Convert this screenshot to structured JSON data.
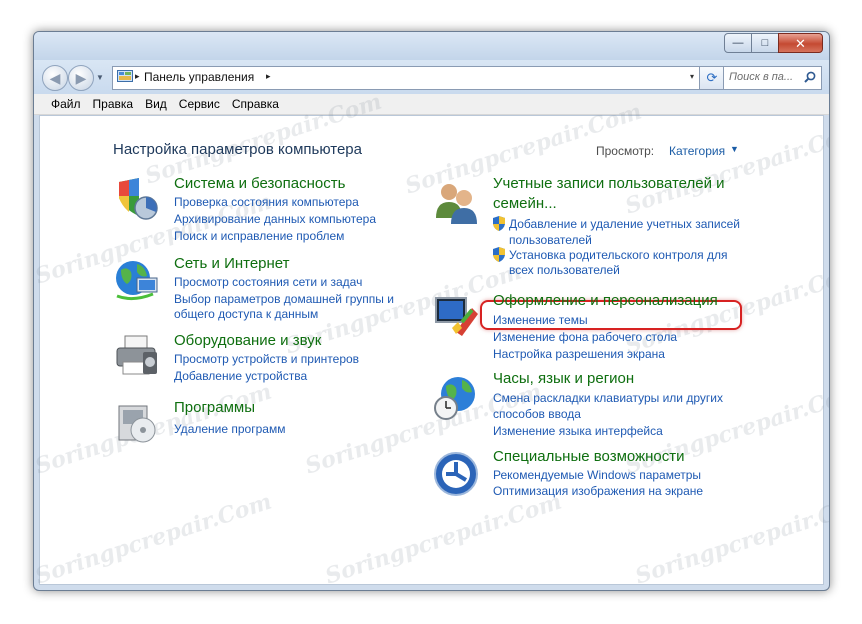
{
  "window": {
    "caption_buttons": {
      "minimize": "—",
      "maximize": "□",
      "close": "✕"
    }
  },
  "nav": {
    "back_icon": "back-arrow-icon",
    "forward_icon": "forward-arrow-icon",
    "address": {
      "separator": "▸",
      "path": "Панель управления",
      "trailing_separator": "▸",
      "dropdown": "▾"
    },
    "refresh_icon": "refresh-icon",
    "search_placeholder": "Поиск в па..."
  },
  "menu": [
    "Файл",
    "Правка",
    "Вид",
    "Сервис",
    "Справка"
  ],
  "content": {
    "title": "Настройка параметров компьютера",
    "view_label": "Просмотр:",
    "view_value": "Категория",
    "view_arrow": "▼",
    "left_categories": [
      {
        "title": "Система и безопасность",
        "icon": "shield-icon",
        "links": [
          "Проверка состояния компьютера",
          "Архивирование данных компьютера",
          "Поиск и исправление проблем"
        ]
      },
      {
        "title": "Сеть и Интернет",
        "icon": "network-globe-icon",
        "links": [
          "Просмотр состояния сети и задач",
          "Выбор параметров домашней группы и",
          "общего доступа к данным"
        ]
      },
      {
        "title": "Оборудование и звук",
        "icon": "printer-icon",
        "links": [
          "Просмотр устройств и принтеров",
          "Добавление устройства"
        ]
      },
      {
        "title": "Программы",
        "icon": "programs-icon",
        "links": [
          "Удаление программ"
        ]
      }
    ],
    "right_categories": [
      {
        "title_line1": "Учетные записи пользователей и",
        "title_line2": "семейн...",
        "icon": "users-icon",
        "links": [
          "Добавление и удаление учетных записей",
          "пользователей",
          "Установка родительского контроля для",
          "всех пользователей"
        ]
      },
      {
        "title": "Оформление и персонализация",
        "icon": "monitor-paint-icon",
        "links": [
          "Изменение темы",
          "Изменение фона рабочего стола",
          "Настройка разрешения экрана"
        ]
      },
      {
        "title": "Часы, язык и регион",
        "icon": "clock-globe-icon",
        "links": [
          "Смена раскладки клавиатуры или других",
          "способов ввода",
          "Изменение языка интерфейса"
        ]
      },
      {
        "title": "Специальные возможности",
        "icon": "accessibility-icon",
        "links": [
          "Рекомендуемые Windows параметры",
          "Оптимизация изображения на экране"
        ]
      }
    ]
  },
  "watermark": "Soringpcrepair.Com",
  "colors": {
    "category_title": "#0f6f10",
    "link": "#1f5ab3",
    "highlight": "#d72222"
  }
}
